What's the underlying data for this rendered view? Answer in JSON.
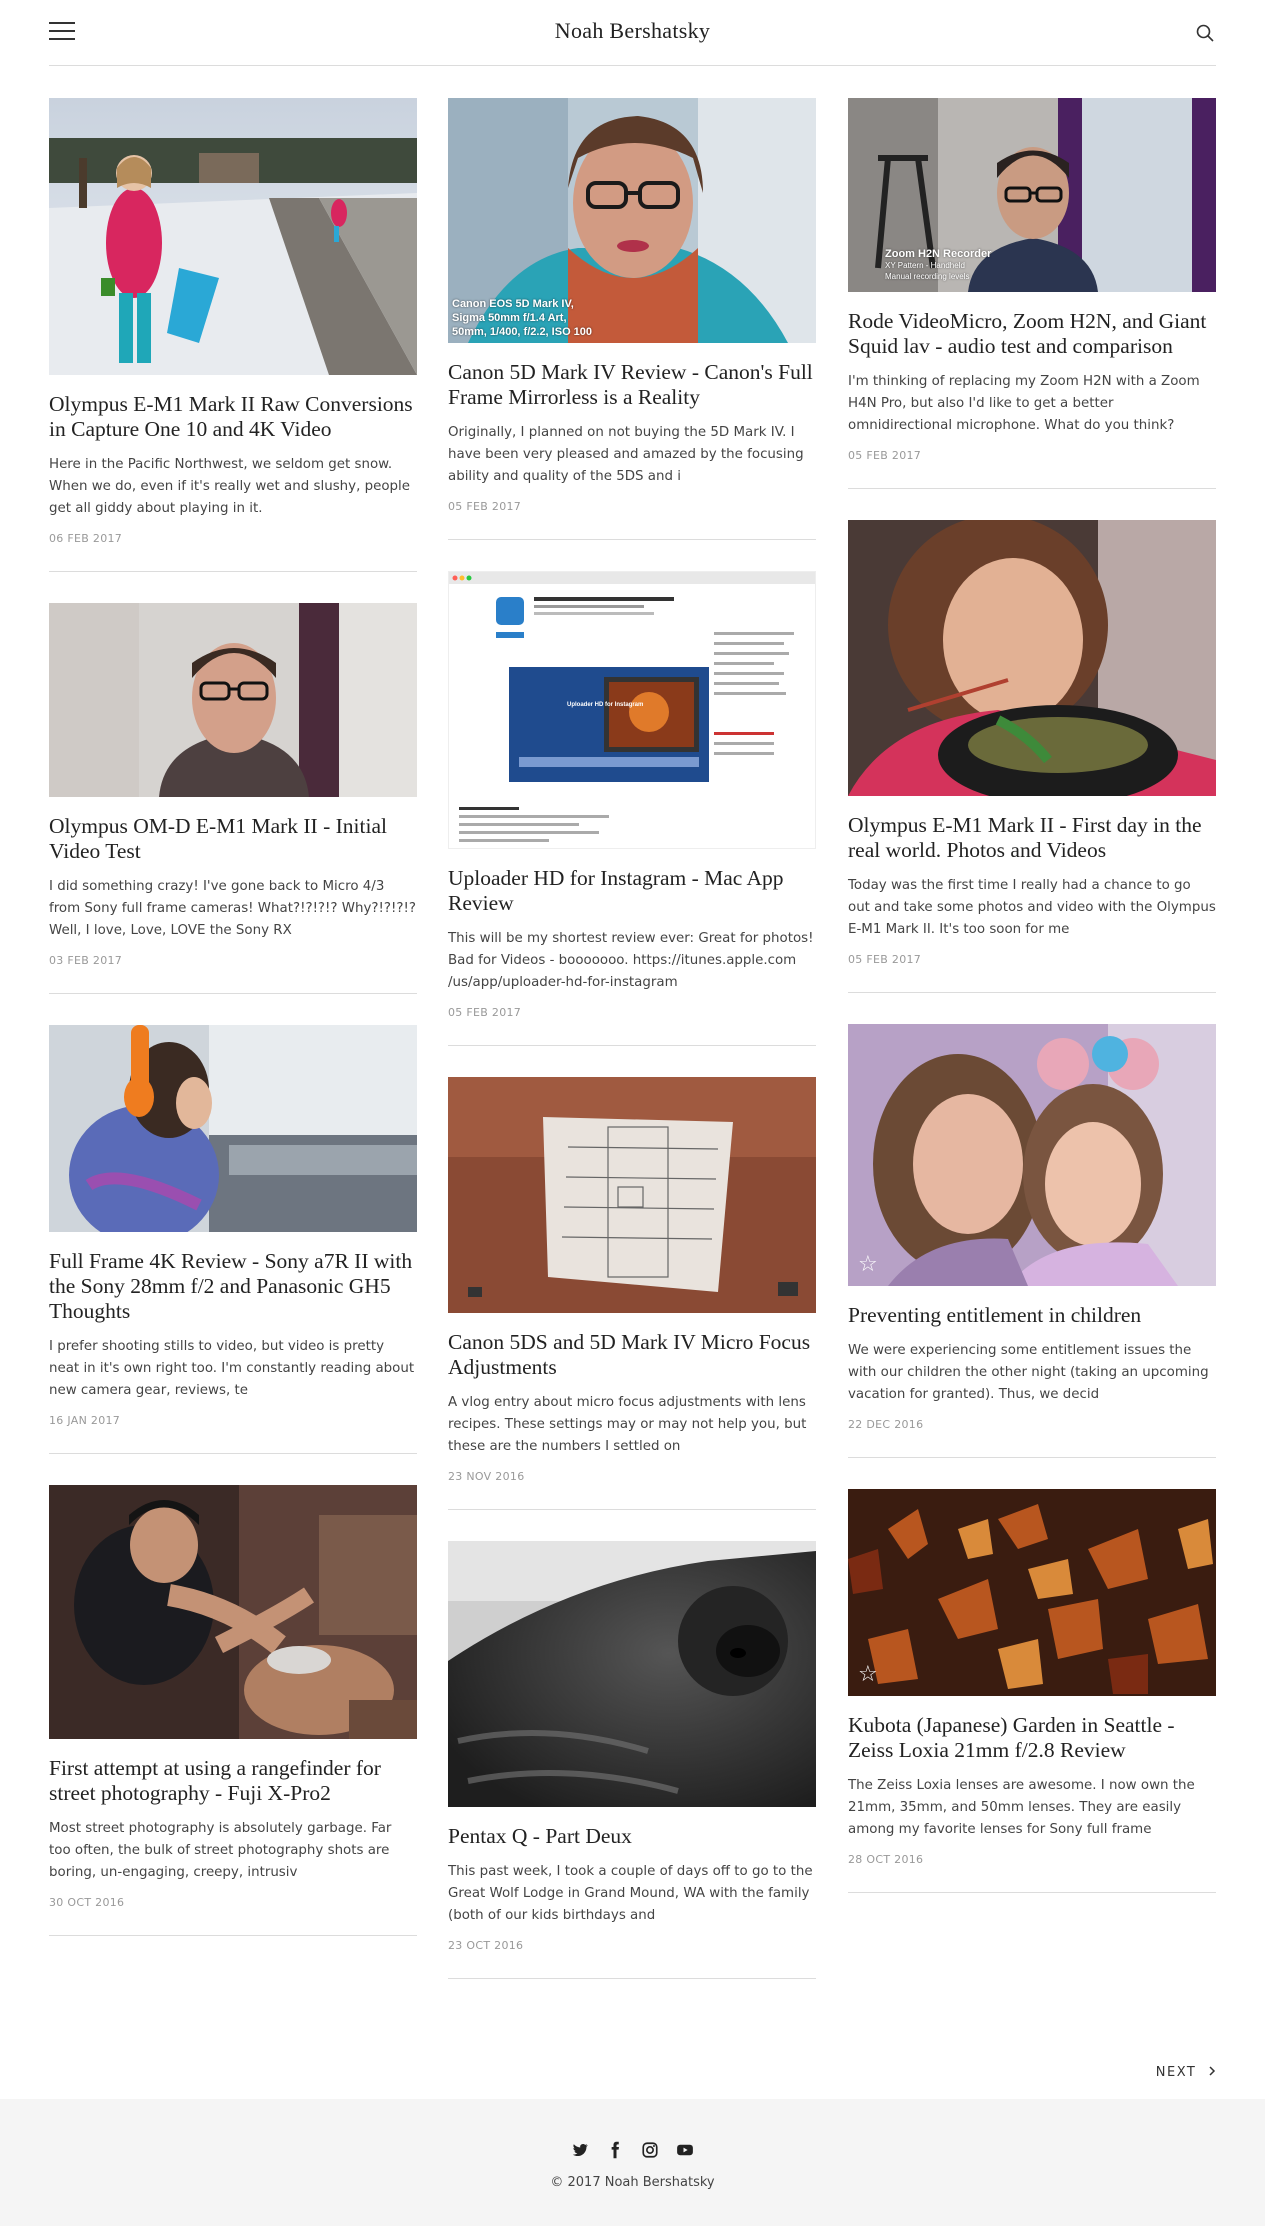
{
  "site": {
    "title": "Noah Bershatsky"
  },
  "posts": [
    {
      "title": "Olympus E-M1 Mark II Raw Conversions in Capture One 10 and 4K Video",
      "excerpt": "Here in the Pacific Northwest, we seldom get snow. When we do, even if it's really wet and slushy, people get all giddy about playing in it.",
      "date": "06 FEB 2017"
    },
    {
      "title": "Olympus OM-D E-M1 Mark II - Initial Video Test",
      "excerpt": "I did something crazy! I've gone back to Micro 4/3 from Sony full frame cameras! What?!?!?!? Why?!?!?!? Well, I love, Love, LOVE the Sony RX",
      "date": "03 FEB 2017"
    },
    {
      "title": "Full Frame 4K Review - Sony a7R II with the Sony 28mm f/2 and Panasonic GH5 Thoughts",
      "excerpt": "I prefer shooting stills to video, but video is pretty neat in it's own right too. I'm constantly reading about new camera gear, reviews, te",
      "date": "16 JAN 2017"
    },
    {
      "title": "First attempt at using a rangefinder for street photography - Fuji X-Pro2",
      "excerpt": "Most street photography is absolutely garbage. Far too often, the bulk of street photography shots are boring, un-engaging, creepy, intrusiv",
      "date": "30 OCT 2016"
    },
    {
      "title": "Canon 5D Mark IV Review - Canon's Full Frame Mirrorless is a Reality",
      "excerpt": "Originally, I planned on not buying the 5D Mark IV. I have been very pleased and amazed by the focusing ability and quality of the 5DS and i",
      "date": "05 FEB 2017",
      "image_caption": [
        "Canon EOS 5D Mark IV,",
        "Sigma 50mm f/1.4 Art,",
        "50mm, 1/400, f/2.2, ISO 100"
      ]
    },
    {
      "title": "Uploader HD for Instagram - Mac App Review",
      "excerpt": "This will be my shortest review ever: Great for photos! Bad for Videos - booooooo. https://itunes.apple.com /us/app/uploader-hd-for-instagram",
      "date": "05 FEB 2017",
      "image_caption": [
        "Uploader HD for Instagram"
      ]
    },
    {
      "title": "Canon 5DS and 5D Mark IV Micro Focus Adjustments",
      "excerpt": "A vlog entry about micro focus adjustments with lens recipes. These settings may or may not help you, but these are the numbers I settled on",
      "date": "23 NOV 2016"
    },
    {
      "title": "Pentax Q - Part Deux",
      "excerpt": "This past week, I took a couple of days off to go to the Great Wolf Lodge in Grand Mound, WA with the family (both of our kids birthdays and",
      "date": "23 OCT 2016"
    },
    {
      "title": "Rode VideoMicro, Zoom H2N, and Giant Squid lav - audio test and comparison",
      "excerpt": "I'm thinking of replacing my Zoom H2N with a Zoom H4N Pro, but also I'd like to get a better omnidirectional microphone. What do you think?",
      "date": "05 FEB 2017",
      "image_caption": [
        "Zoom H2N Recorder",
        "XY Pattern - Handheld",
        "Manual recording levels"
      ]
    },
    {
      "title": "Olympus E-M1 Mark II - First day in the real world. Photos and Videos",
      "excerpt": "Today was the first time I really had a chance to go out and take some photos and video with the Olympus E-M1 Mark II. It's too soon for me",
      "date": "05 FEB 2017"
    },
    {
      "title": "Preventing entitlement in children",
      "excerpt": "We were experiencing some entitlement issues the with our children the other night (taking an upcoming vacation for granted). Thus, we decid",
      "date": "22 DEC 2016"
    },
    {
      "title": "Kubota (Japanese) Garden in Seattle - Zeiss Loxia 21mm f/2.8 Review",
      "excerpt": "The Zeiss Loxia lenses are awesome. I now own the 21mm, 35mm, and 50mm lenses. They are easily among my favorite lenses for Sony full frame",
      "date": "28 OCT 2016"
    }
  ],
  "pagination": {
    "next_label": "NEXT"
  },
  "footer": {
    "social_icons": [
      "twitter-icon",
      "facebook-icon",
      "instagram-icon",
      "youtube-icon"
    ],
    "copyright": "© 2017 Noah Bershatsky"
  }
}
